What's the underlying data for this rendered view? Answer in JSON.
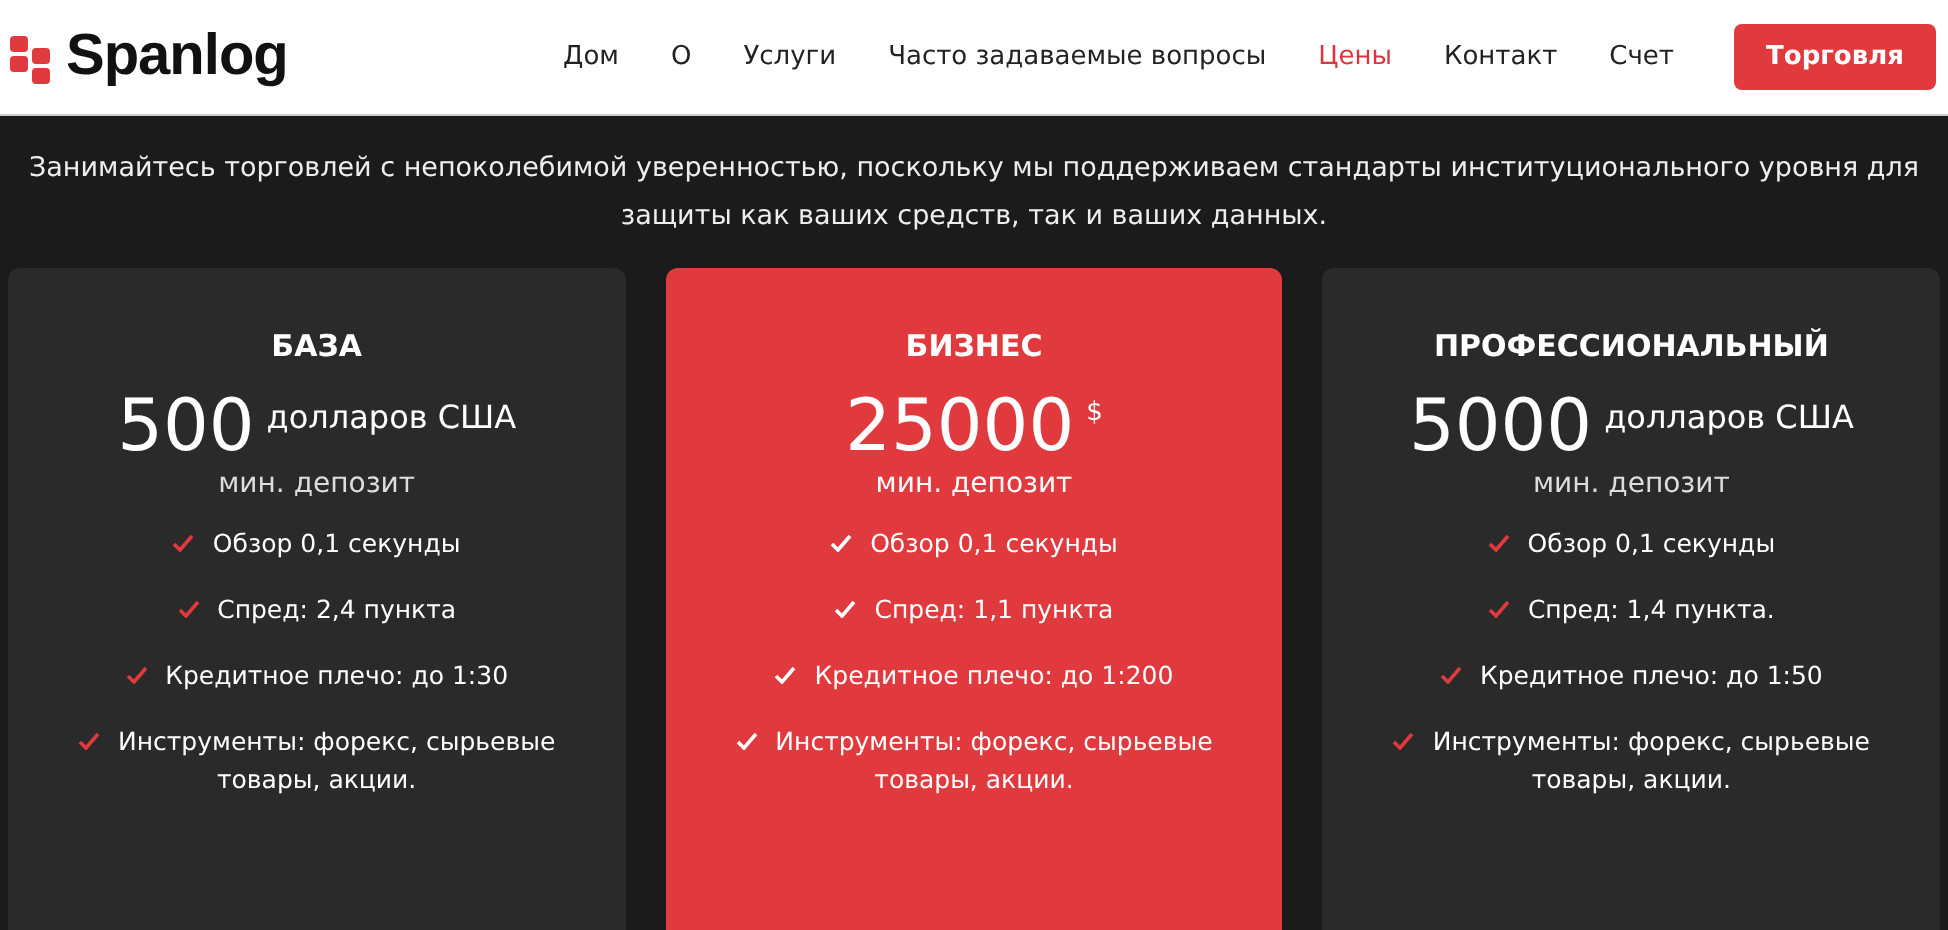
{
  "header": {
    "logo": "Spanlog",
    "nav": [
      {
        "label": "Дом",
        "selected": false
      },
      {
        "label": "О",
        "selected": false
      },
      {
        "label": "Услуги",
        "selected": false
      },
      {
        "label": "Часто задаваемые вопросы",
        "selected": false
      },
      {
        "label": "Цены",
        "selected": true
      },
      {
        "label": "Контакт",
        "selected": false
      },
      {
        "label": "Счет",
        "selected": false
      }
    ],
    "cta": "Торговля"
  },
  "intro": "Занимайтесь торговлей с непоколебимой уверенностью, поскольку мы поддерживаем стандарты институционального уровня для защиты как ваших средств, так и ваших данных.",
  "plans": [
    {
      "title": "БАЗА",
      "amount": "500",
      "currency": "долларов США",
      "note": "мин. депозит",
      "highlighted": false,
      "features": [
        "Обзор 0,1 секунды",
        "Спред: 2,4 пункта",
        "Кредитное плечо: до 1:30",
        "Инструменты: форекс, сырьевые товары, акции."
      ]
    },
    {
      "title": "БИЗНЕС",
      "amount": "25000",
      "currency": "$",
      "note": "мин. депозит",
      "highlighted": true,
      "features": [
        "Обзор 0,1 секунды",
        "Спред: 1,1 пункта",
        "Кредитное плечо: до 1:200",
        "Инструменты: форекс, сырьевые товары, акции."
      ]
    },
    {
      "title": "ПРОФЕССИОНАЛЬНЫЙ",
      "amount": "5000",
      "currency": "долларов США",
      "note": "мин. депозит",
      "highlighted": false,
      "features": [
        "Обзор 0,1 секунды",
        "Спред: 1,4 пункта.",
        "Кредитное плечо: до 1:50",
        "Инструменты: форекс, сырьевые товары, акции."
      ]
    }
  ]
}
